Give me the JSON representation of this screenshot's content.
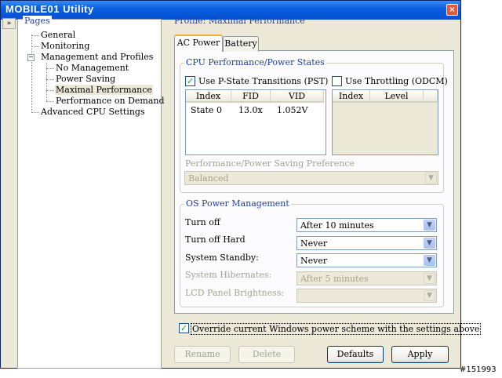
{
  "window": {
    "title": "MOBILE01  Utility"
  },
  "icons": {
    "close": "×",
    "collapse": "»",
    "tree_minus": "−",
    "check": "✓",
    "dropdown": "▼"
  },
  "pages": {
    "legend": "Pages",
    "items": [
      {
        "label": "General"
      },
      {
        "label": "Monitoring"
      },
      {
        "label": "Management and Profiles"
      },
      {
        "label": "No Management"
      },
      {
        "label": "Power Saving"
      },
      {
        "label": "Maximal Performance"
      },
      {
        "label": "Performance on Demand"
      },
      {
        "label": "Advanced CPU Settings"
      }
    ]
  },
  "profile": {
    "title": "Profile: Maximal Performance"
  },
  "tabs": [
    {
      "label": "AC Power"
    },
    {
      "label": "Battery"
    }
  ],
  "cpu": {
    "legend": "CPU Performance/Power States",
    "pst_label": "Use P-State Transitions (PST)",
    "pst_checked": true,
    "pst_columns": [
      "Index",
      "FID",
      "VID"
    ],
    "pst_rows": [
      {
        "index": "State 0",
        "fid": "13.0x",
        "vid": "1.052V"
      }
    ],
    "throttling_label": "Use Throttling (ODCM)",
    "throttling_checked": false,
    "throttling_columns": [
      "Index",
      "Level"
    ],
    "preference_label": "Performance/Power Saving Preference",
    "preference_value": "Balanced"
  },
  "os_power": {
    "legend": "OS Power Management",
    "rows": [
      {
        "label": "Turn off",
        "value": "After 10 minutes",
        "enabled": true
      },
      {
        "label": "Turn off Hard",
        "value": "Never",
        "enabled": true
      },
      {
        "label": "System Standby:",
        "value": "Never",
        "enabled": true
      },
      {
        "label": "System Hibernates:",
        "value": "After 5 minutes",
        "enabled": false
      },
      {
        "label": "LCD Panel Brightness:",
        "value": "",
        "enabled": false
      }
    ]
  },
  "override": {
    "label": "Override current Windows power scheme with the settings above",
    "checked": true
  },
  "buttons": {
    "rename": "Rename",
    "delete": "Delete",
    "defaults": "Defaults",
    "apply": "Apply"
  },
  "watermark": "#151993"
}
